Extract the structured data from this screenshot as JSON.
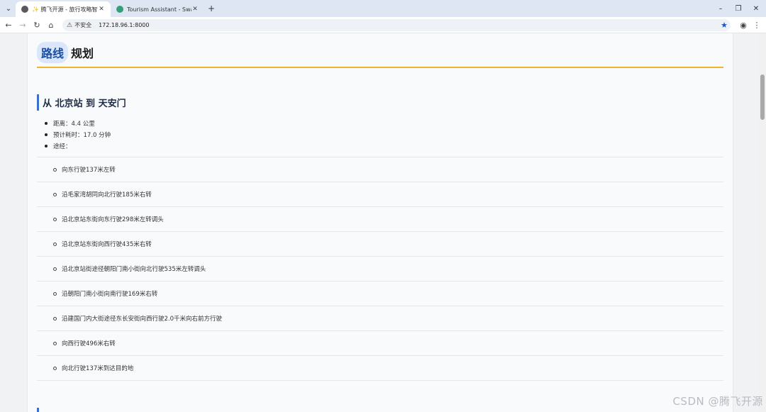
{
  "browser": {
    "tabs": [
      {
        "title": "✨ 腾飞开源 - 旅行攻略智能助手",
        "active": true
      },
      {
        "title": "Tourism Assistant - Swagger UI",
        "active": false
      }
    ],
    "new_tab": "+",
    "address": {
      "security_label": "不安全",
      "url": "172.18.96.1:8000"
    }
  },
  "page": {
    "section_title_highlight": "路线",
    "section_title_rest": "规划",
    "route_heading": "从 北京站 到 天安门",
    "summary": [
      "距离：4.4 公里",
      "预计耗时：17.0 分钟",
      "途经："
    ],
    "steps": [
      "向东行驶137米左转",
      "沿毛家湾胡同向北行驶185米右转",
      "沿北京站东街向东行驶298米左转调头",
      "沿北京站东街向西行驶435米右转",
      "沿北京站街途径朝阳门南小街向北行驶535米左转调头",
      "沿朝阳门南小街向南行驶169米右转",
      "沿建国门内大街途径东长安街向西行驶2.0千米向右前方行驶",
      "向西行驶496米右转",
      "向北行驶137米到达目的地"
    ]
  },
  "watermark": "CSDN @腾飞开源",
  "colors": {
    "accent_rule": "#f0b42a",
    "heading_bar": "#3b6fcf",
    "highlight_bg": "#d9e6fb"
  }
}
